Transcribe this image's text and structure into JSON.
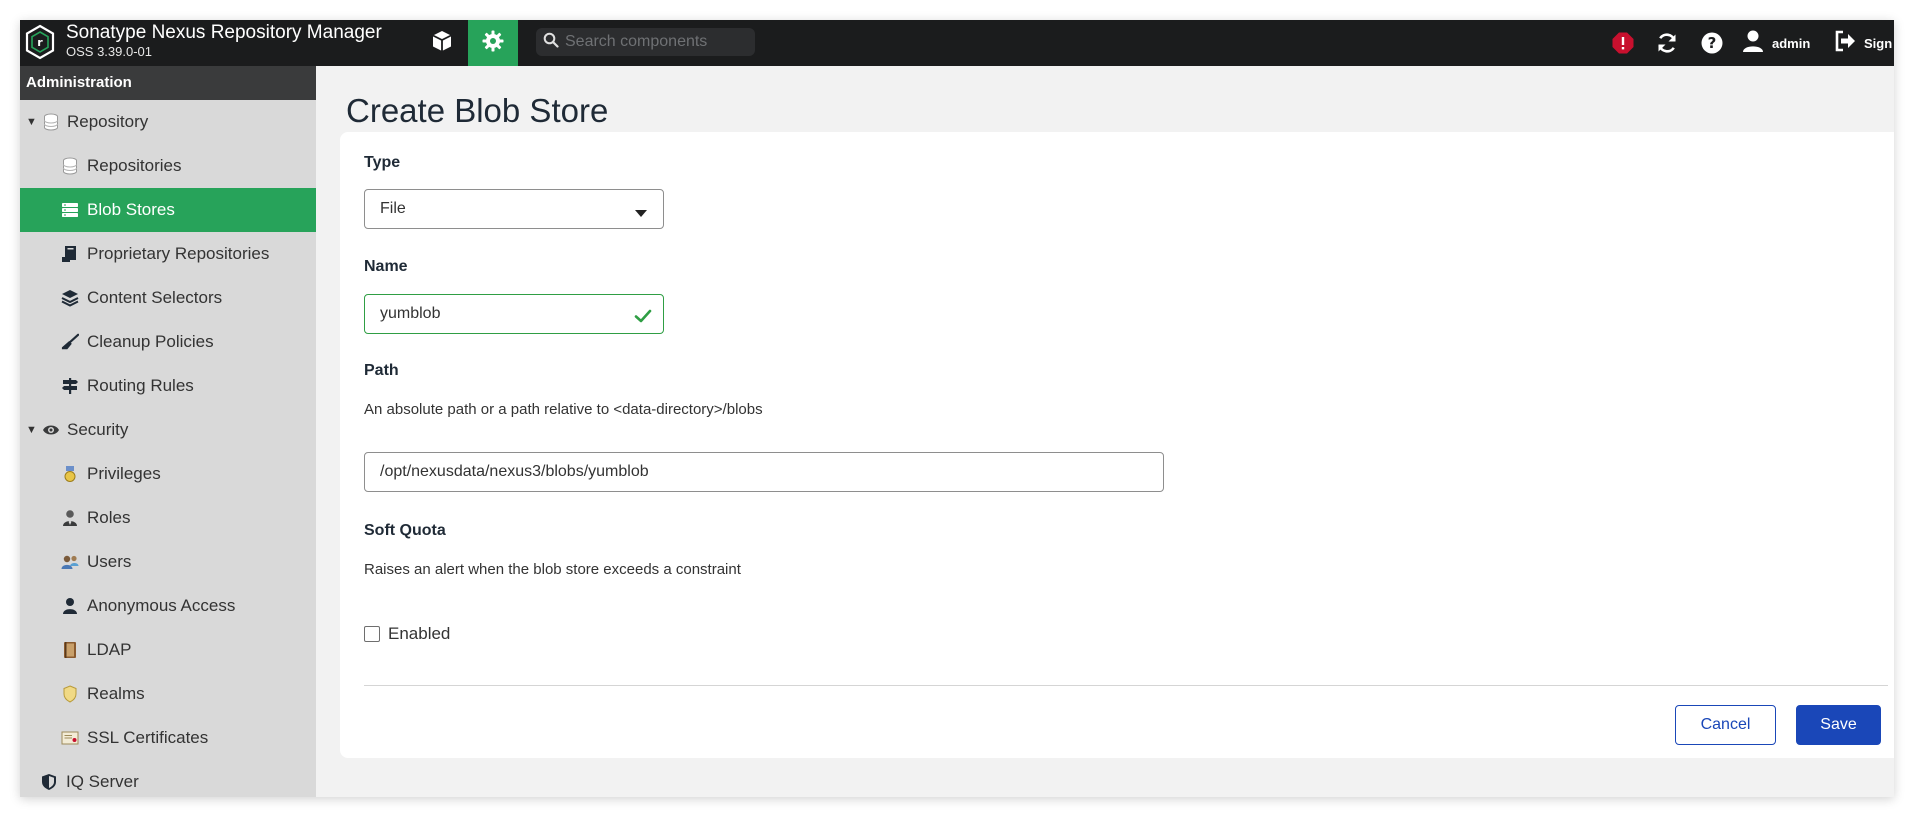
{
  "app": {
    "title": "Sonatype Nexus Repository Manager",
    "version": "OSS 3.39.0-01",
    "search_placeholder": "Search components",
    "user_label": "admin",
    "signout_label": "Sign"
  },
  "sidebar": {
    "header": "Administration",
    "items": [
      {
        "label": "Repository",
        "icon": "database-icon",
        "level": 0,
        "expanded": true
      },
      {
        "label": "Repositories",
        "icon": "database-icon",
        "level": 1
      },
      {
        "label": "Blob Stores",
        "icon": "server-stack-icon",
        "level": 1,
        "active": true
      },
      {
        "label": "Proprietary Repositories",
        "icon": "proprietary-icon",
        "level": 1
      },
      {
        "label": "Content Selectors",
        "icon": "layers-icon",
        "level": 1
      },
      {
        "label": "Cleanup Policies",
        "icon": "broom-icon",
        "level": 1
      },
      {
        "label": "Routing Rules",
        "icon": "signpost-icon",
        "level": 1
      },
      {
        "label": "Security",
        "icon": "eye-icon",
        "level": 0,
        "expanded": true
      },
      {
        "label": "Privileges",
        "icon": "medal-icon",
        "level": 1
      },
      {
        "label": "Roles",
        "icon": "user-tie-icon",
        "level": 1
      },
      {
        "label": "Users",
        "icon": "users-icon",
        "level": 1
      },
      {
        "label": "Anonymous Access",
        "icon": "user-icon",
        "level": 1
      },
      {
        "label": "LDAP",
        "icon": "book-icon",
        "level": 1
      },
      {
        "label": "Realms",
        "icon": "shield-icon",
        "level": 1
      },
      {
        "label": "SSL Certificates",
        "icon": "certificate-icon",
        "level": 1
      },
      {
        "label": "IQ Server",
        "icon": "shield-half-icon",
        "level": 0
      }
    ]
  },
  "page": {
    "title": "Create Blob Store"
  },
  "form": {
    "type_label": "Type",
    "type_value": "File",
    "name_label": "Name",
    "name_value": "yumblob",
    "path_label": "Path",
    "path_description": "An absolute path or a path relative to <data-directory>/blobs",
    "path_value": "/opt/nexusdata/nexus3/blobs/yumblob",
    "soft_quota_label": "Soft Quota",
    "soft_quota_description": "Raises an alert when the blob store exceeds a constraint",
    "enabled_label": "Enabled",
    "enabled_checked": false,
    "cancel_label": "Cancel",
    "save_label": "Save"
  },
  "colors": {
    "accent_green": "#27a35a",
    "primary_blue": "#1a47b8",
    "alert_red": "#c8102e",
    "topbar_bg": "#1b1c1d"
  }
}
